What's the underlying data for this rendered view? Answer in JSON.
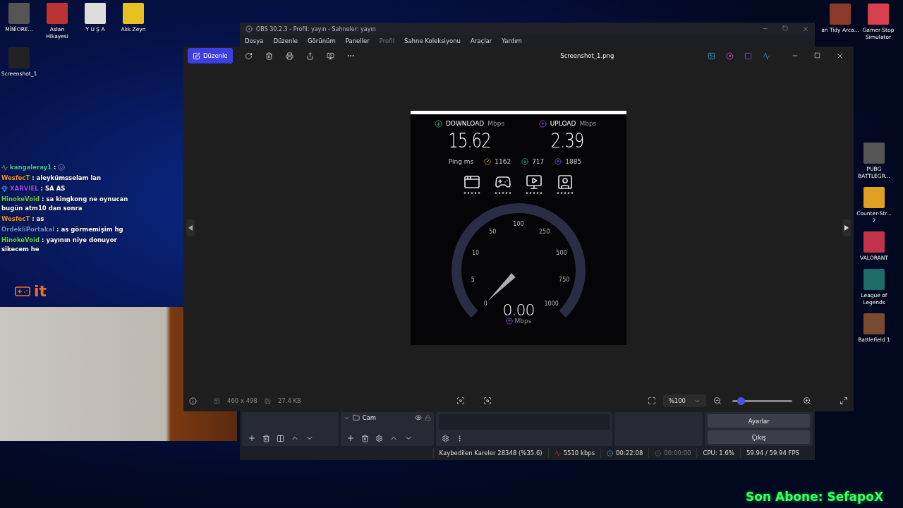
{
  "desktop": {
    "left_icons": [
      {
        "label": "MİNİORE..."
      },
      {
        "label": "Aslan Hikayesi"
      },
      {
        "label": "Y U Ş A"
      },
      {
        "label": "Alık Zeyn"
      },
      {
        "label": "Screenshot_1"
      }
    ],
    "right_icons": [
      {
        "label": "an Tidy Arca..."
      },
      {
        "label": "Gamer Stop Simulator"
      },
      {
        "label": "PUBG BATTLEGR..."
      },
      {
        "label": "Counter-Str... 2"
      },
      {
        "label": "VALORANT"
      },
      {
        "label": "League of Legends"
      },
      {
        "label": "Battlefield 1"
      }
    ]
  },
  "chat": [
    {
      "user": "kangaleray1",
      "color": "#3fc8a0",
      "text": ":",
      "badge": true,
      "emote": true
    },
    {
      "user": "WesfecT",
      "color": "#e8922e",
      "text": ": aleykümsselam lan",
      "badge": false,
      "emote": false
    },
    {
      "user": "XARVIEL",
      "color": "#9b4dff",
      "text": ": SA AS",
      "badge": true,
      "emote": false
    },
    {
      "user": "HinokeVoid",
      "color": "#66d14b",
      "text": ": sa kingkong ne oynucan bugün atm10 dan sonra",
      "badge": false,
      "emote": false
    },
    {
      "user": "WesfecT",
      "color": "#e8922e",
      "text": ": as",
      "badge": false,
      "emote": false
    },
    {
      "user": "OrdekliPortakal",
      "color": "#6e8fd0",
      "text": ": as görmemişim hg",
      "badge": false,
      "emote": false
    },
    {
      "user": "HinokeVoid",
      "color": "#66d14b",
      "text": ": yayının niye donuyor sikecem he",
      "badge": false,
      "emote": false
    }
  ],
  "overlay_logo": "it",
  "subscriber_banner": "Son Abone: SefapoX",
  "obs": {
    "title": "OBS 30.2.3 - Profil: yayın - Sahneler: yayın",
    "menu": [
      {
        "label": "Dosya",
        "disabled": false
      },
      {
        "label": "Düzenle",
        "disabled": false
      },
      {
        "label": "Görünüm",
        "disabled": false
      },
      {
        "label": "Paneller",
        "disabled": false
      },
      {
        "label": "Profil",
        "disabled": true
      },
      {
        "label": "Sahne Koleksiyonu",
        "disabled": false
      },
      {
        "label": "Araçlar",
        "disabled": false
      },
      {
        "label": "Yardım",
        "disabled": false
      }
    ],
    "sources": [
      {
        "label": "Cam"
      }
    ],
    "buttons": [
      "Ayarlar",
      "Çıkış"
    ],
    "status": {
      "dropped": "Kaybedilen Kareler 28348 (%35.6)",
      "bitrate": "5510 kbps",
      "stream_time": "00:22:08",
      "rec_time": "00:00:00",
      "cpu": "CPU: 1.6%",
      "fps": "59.94 / 59.94 FPS"
    }
  },
  "viewer": {
    "edit_button": "Düzenle",
    "title": "Screenshot_1.png",
    "dimensions": "460 x 498",
    "file_size": "27.4 KB",
    "zoom": "%100",
    "zoom_slider": {
      "level": 0.15
    }
  },
  "speedtest": {
    "download_label": "DOWNLOAD",
    "upload_label": "UPLOAD",
    "download_unit": "Mbps",
    "upload_unit": "Mbps",
    "download": "15.62",
    "upload": "2.39",
    "ping_label": "Ping ms",
    "ping_idle": "1162",
    "ping_down": "717",
    "ping_up": "1885",
    "gauge": {
      "ticks": [
        "0",
        "5",
        "10",
        "50",
        "100",
        "250",
        "500",
        "750",
        "1000"
      ],
      "value": "0.00",
      "unit": "Mbps"
    }
  }
}
